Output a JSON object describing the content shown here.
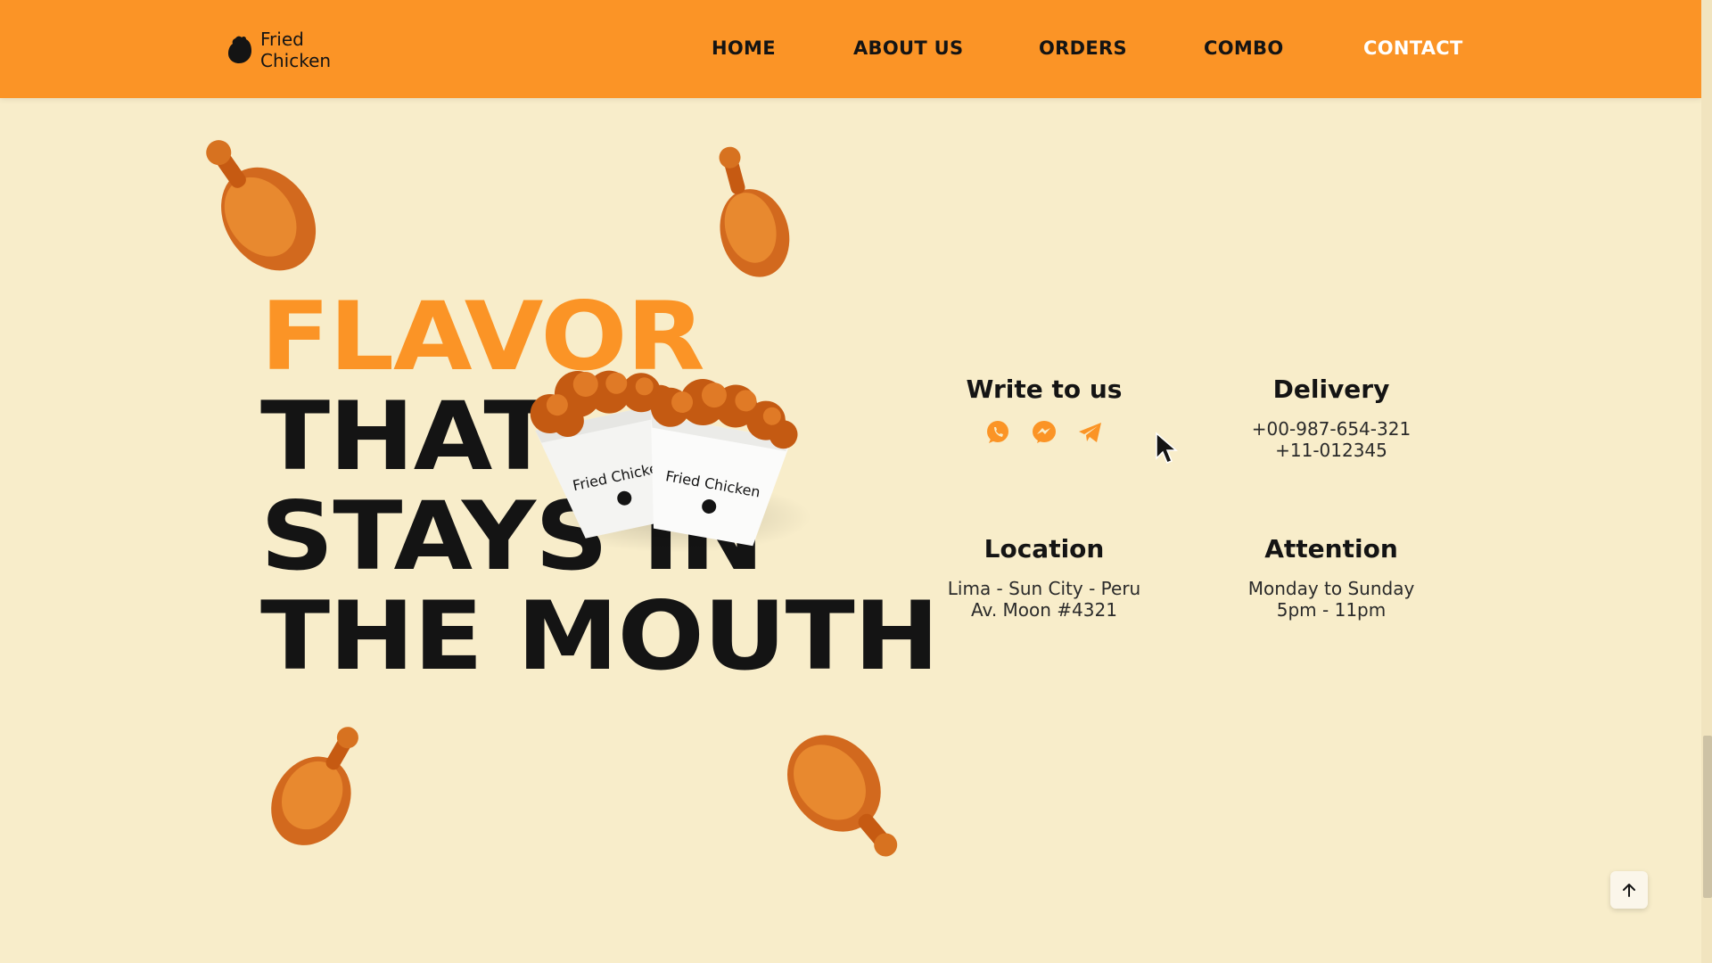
{
  "brand": {
    "line1": "Fried",
    "line2": "Chicken"
  },
  "nav": {
    "items": [
      {
        "label": "HOME"
      },
      {
        "label": "ABOUT US"
      },
      {
        "label": "ORDERS"
      },
      {
        "label": "COMBO"
      },
      {
        "label": "CONTACT",
        "active": true
      }
    ]
  },
  "hero": {
    "line1": "FLAVOR",
    "line2": "THAT",
    "line3": "STAYS IN",
    "line4": "THE MOUTH",
    "bucket_text": "Fried Chicken"
  },
  "contact": {
    "write": {
      "title": "Write to us",
      "icons": [
        "whatsapp-icon",
        "messenger-icon",
        "telegram-icon"
      ]
    },
    "delivery": {
      "title": "Delivery",
      "line1": "+00-987-654-321",
      "line2": "+11-012345"
    },
    "location": {
      "title": "Location",
      "line1": "Lima - Sun City - Peru",
      "line2": "Av. Moon #4321"
    },
    "attention": {
      "title": "Attention",
      "line1": "Monday to Sunday",
      "line2": "5pm - 11pm"
    }
  },
  "colors": {
    "accent": "#fb9426",
    "background": "#f8edca",
    "text": "#141414",
    "active_nav": "#ffffff"
  }
}
